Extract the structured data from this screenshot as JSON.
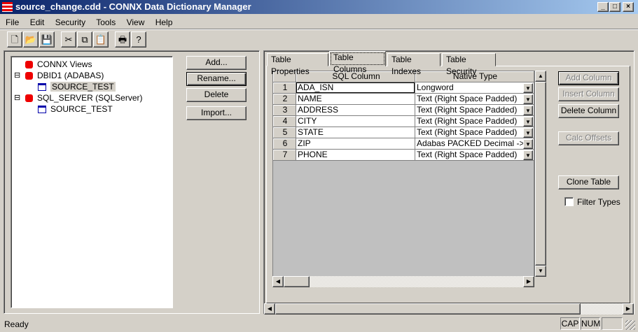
{
  "window": {
    "title": "source_change.cdd - CONNX Data Dictionary Manager",
    "controls": [
      "_",
      "□",
      "×"
    ]
  },
  "menu": [
    "File",
    "Edit",
    "Security",
    "Tools",
    "View",
    "Help"
  ],
  "toolbar": [
    {
      "icon": "new-icon",
      "glyph": "🗋"
    },
    {
      "icon": "open-icon",
      "glyph": "📂"
    },
    {
      "icon": "save-icon",
      "glyph": "💾"
    },
    {
      "icon": "cut-icon",
      "glyph": "✂"
    },
    {
      "icon": "copy-icon",
      "glyph": "⧉"
    },
    {
      "icon": "paste-icon",
      "glyph": "📋"
    },
    {
      "icon": "print-icon",
      "glyph": "🖶"
    },
    {
      "icon": "help-icon",
      "glyph": "?"
    }
  ],
  "tree": [
    {
      "label": "CONNX Views",
      "type": "db",
      "expander": ""
    },
    {
      "label": "DBID1 (ADABAS)",
      "type": "db",
      "expander": "⊟"
    },
    {
      "label": "SOURCE_TEST",
      "type": "table",
      "selected": true
    },
    {
      "label": "SQL_SERVER (SQLServer)",
      "type": "db",
      "expander": "⊟"
    },
    {
      "label": "SOURCE_TEST",
      "type": "table"
    }
  ],
  "left_buttons": [
    "Add...",
    "Rename...",
    "Delete",
    "Import..."
  ],
  "tabs": [
    "Table Properties",
    "Table Columns",
    "Table Indexes",
    "Table Security"
  ],
  "active_tab": "Table Columns",
  "grid": {
    "headers": [
      "",
      "SQL Column",
      "Native Type"
    ],
    "rows": [
      {
        "n": "1",
        "col": "ADA_ISN",
        "type": "Longword"
      },
      {
        "n": "2",
        "col": "NAME",
        "type": "Text (Right Space Padded)"
      },
      {
        "n": "3",
        "col": "ADDRESS",
        "type": "Text (Right Space Padded)"
      },
      {
        "n": "4",
        "col": "CITY",
        "type": "Text (Right Space Padded)"
      },
      {
        "n": "5",
        "col": "STATE",
        "type": "Text (Right Space Padded)"
      },
      {
        "n": "6",
        "col": "ZIP",
        "type": "Adabas PACKED Decimal -> Int"
      },
      {
        "n": "7",
        "col": "PHONE",
        "type": "Text (Right Space Padded)"
      }
    ]
  },
  "right_buttons": {
    "add_column": "Add Column",
    "insert_column": "Insert Column",
    "delete_column": "Delete Column",
    "calc_offsets": "Calc Offsets",
    "clone_table": "Clone Table"
  },
  "filter_types": {
    "label": "Filter Types",
    "checked": false
  },
  "status": {
    "text": "Ready",
    "cap": "CAP",
    "num": "NUM",
    "scrl": ""
  }
}
